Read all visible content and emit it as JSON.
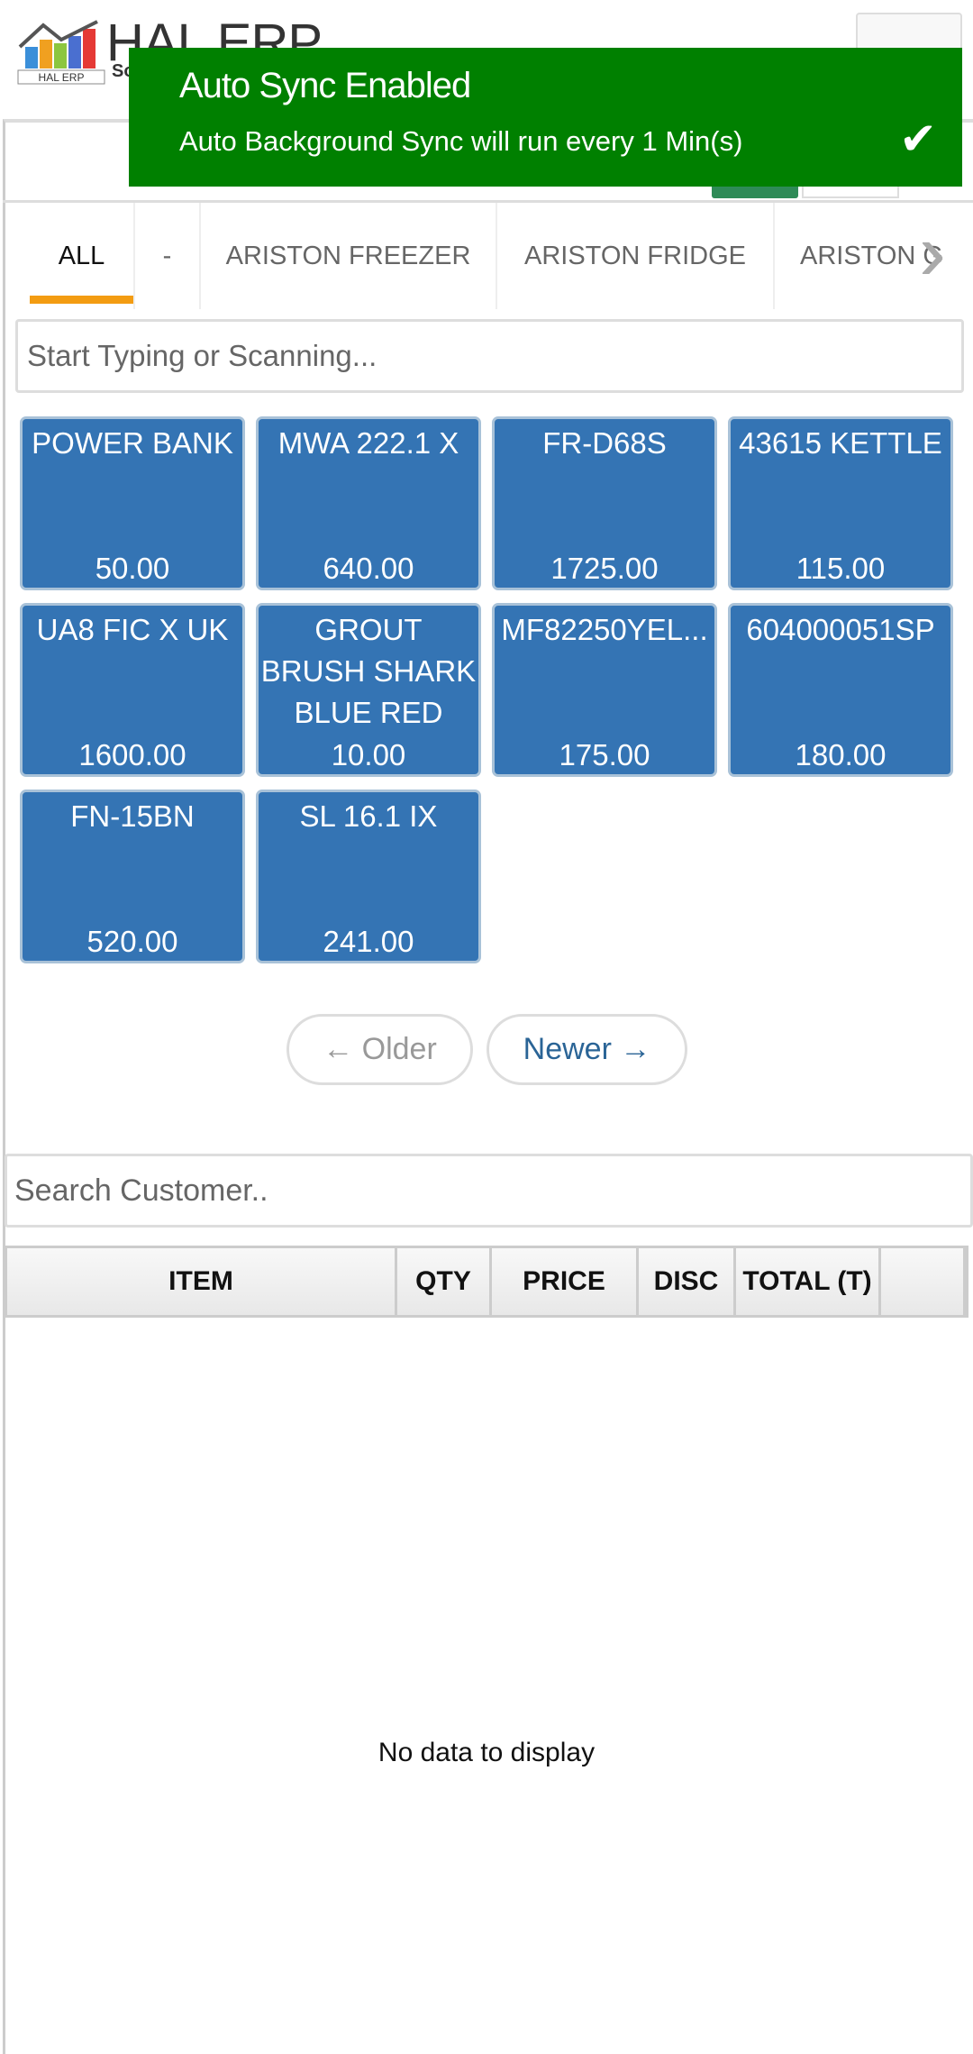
{
  "header": {
    "logo_text": "HAL ERP",
    "logo_badge": "HAL ERP",
    "logo_sub": "So"
  },
  "toast": {
    "title": "Auto Sync Enabled",
    "message": "Auto Background Sync will run every 1 Min(s)",
    "icon": "check-icon",
    "color": "#008000"
  },
  "tabs": [
    {
      "label": "ALL",
      "active": true
    },
    {
      "label": "-"
    },
    {
      "label": "ARISTON FREEZER"
    },
    {
      "label": "ARISTON FRIDGE"
    },
    {
      "label": "ARISTON G"
    }
  ],
  "search": {
    "placeholder": "Start Typing or Scanning..."
  },
  "products": [
    {
      "name": "POWER BANK",
      "price": "50.00"
    },
    {
      "name": "MWA 222.1 X",
      "price": "640.00"
    },
    {
      "name": "FR-D68S",
      "price": "1725.00"
    },
    {
      "name": "43615 KETTLE",
      "price": "115.00"
    },
    {
      "name": "UA8 FIC X UK",
      "price": "1600.00"
    },
    {
      "name": "GROUT BRUSH SHARK BLUE RED",
      "price": "10.00"
    },
    {
      "name": "MF82250YEL...",
      "price": "175.00"
    },
    {
      "name": "604000051SP",
      "price": "180.00"
    },
    {
      "name": "FN-15BN",
      "price": "520.00"
    },
    {
      "name": "SL 16.1 IX",
      "price": "241.00"
    }
  ],
  "pagination": {
    "older": "← Older",
    "newer": "Newer →"
  },
  "customer": {
    "placeholder": "Search Customer.."
  },
  "table": {
    "columns": [
      "ITEM",
      "QTY",
      "PRICE",
      "DISC",
      "TOTAL (T)",
      ""
    ],
    "empty": "No data to display"
  },
  "colors": {
    "tile": "#3474b4",
    "accent": "#f39c12"
  }
}
